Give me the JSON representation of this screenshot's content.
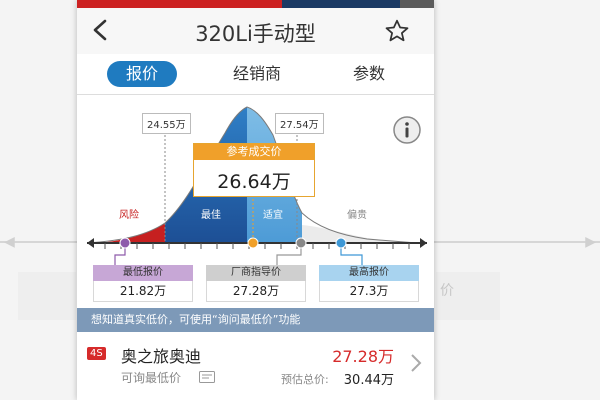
{
  "header": {
    "title": "320Li手动型"
  },
  "tabs": [
    {
      "label": "报价",
      "active": true
    },
    {
      "label": "经销商",
      "active": false
    },
    {
      "label": "参数",
      "active": false
    }
  ],
  "price_chart": {
    "low_tag": "24.55万",
    "high_tag": "27.54万",
    "ref_title": "参考成交价",
    "ref_value": "26.64万",
    "zones": [
      "风险",
      "最佳",
      "适宜",
      "偏贵"
    ],
    "captions": [
      {
        "label": "最低报价",
        "value": "21.82万"
      },
      {
        "label": "厂商指导价",
        "value": "27.28万"
      },
      {
        "label": "最高报价",
        "value": "27.3万"
      }
    ]
  },
  "background": {
    "ghost_text": "价"
  },
  "banner": {
    "text": "想知道真实低价，可使用“询问最低价”功能"
  },
  "dealer": {
    "badge": "4S",
    "name": "奥之旅奥迪",
    "price": "27.28万",
    "inquiry": "可询最低价",
    "est_label": "预估总价:",
    "est_price": "30.44万"
  },
  "colors": {
    "accent": "#1f7bc0",
    "risk": "#c62020",
    "reference": "#f0a02a",
    "banner": "#7d99b8"
  }
}
